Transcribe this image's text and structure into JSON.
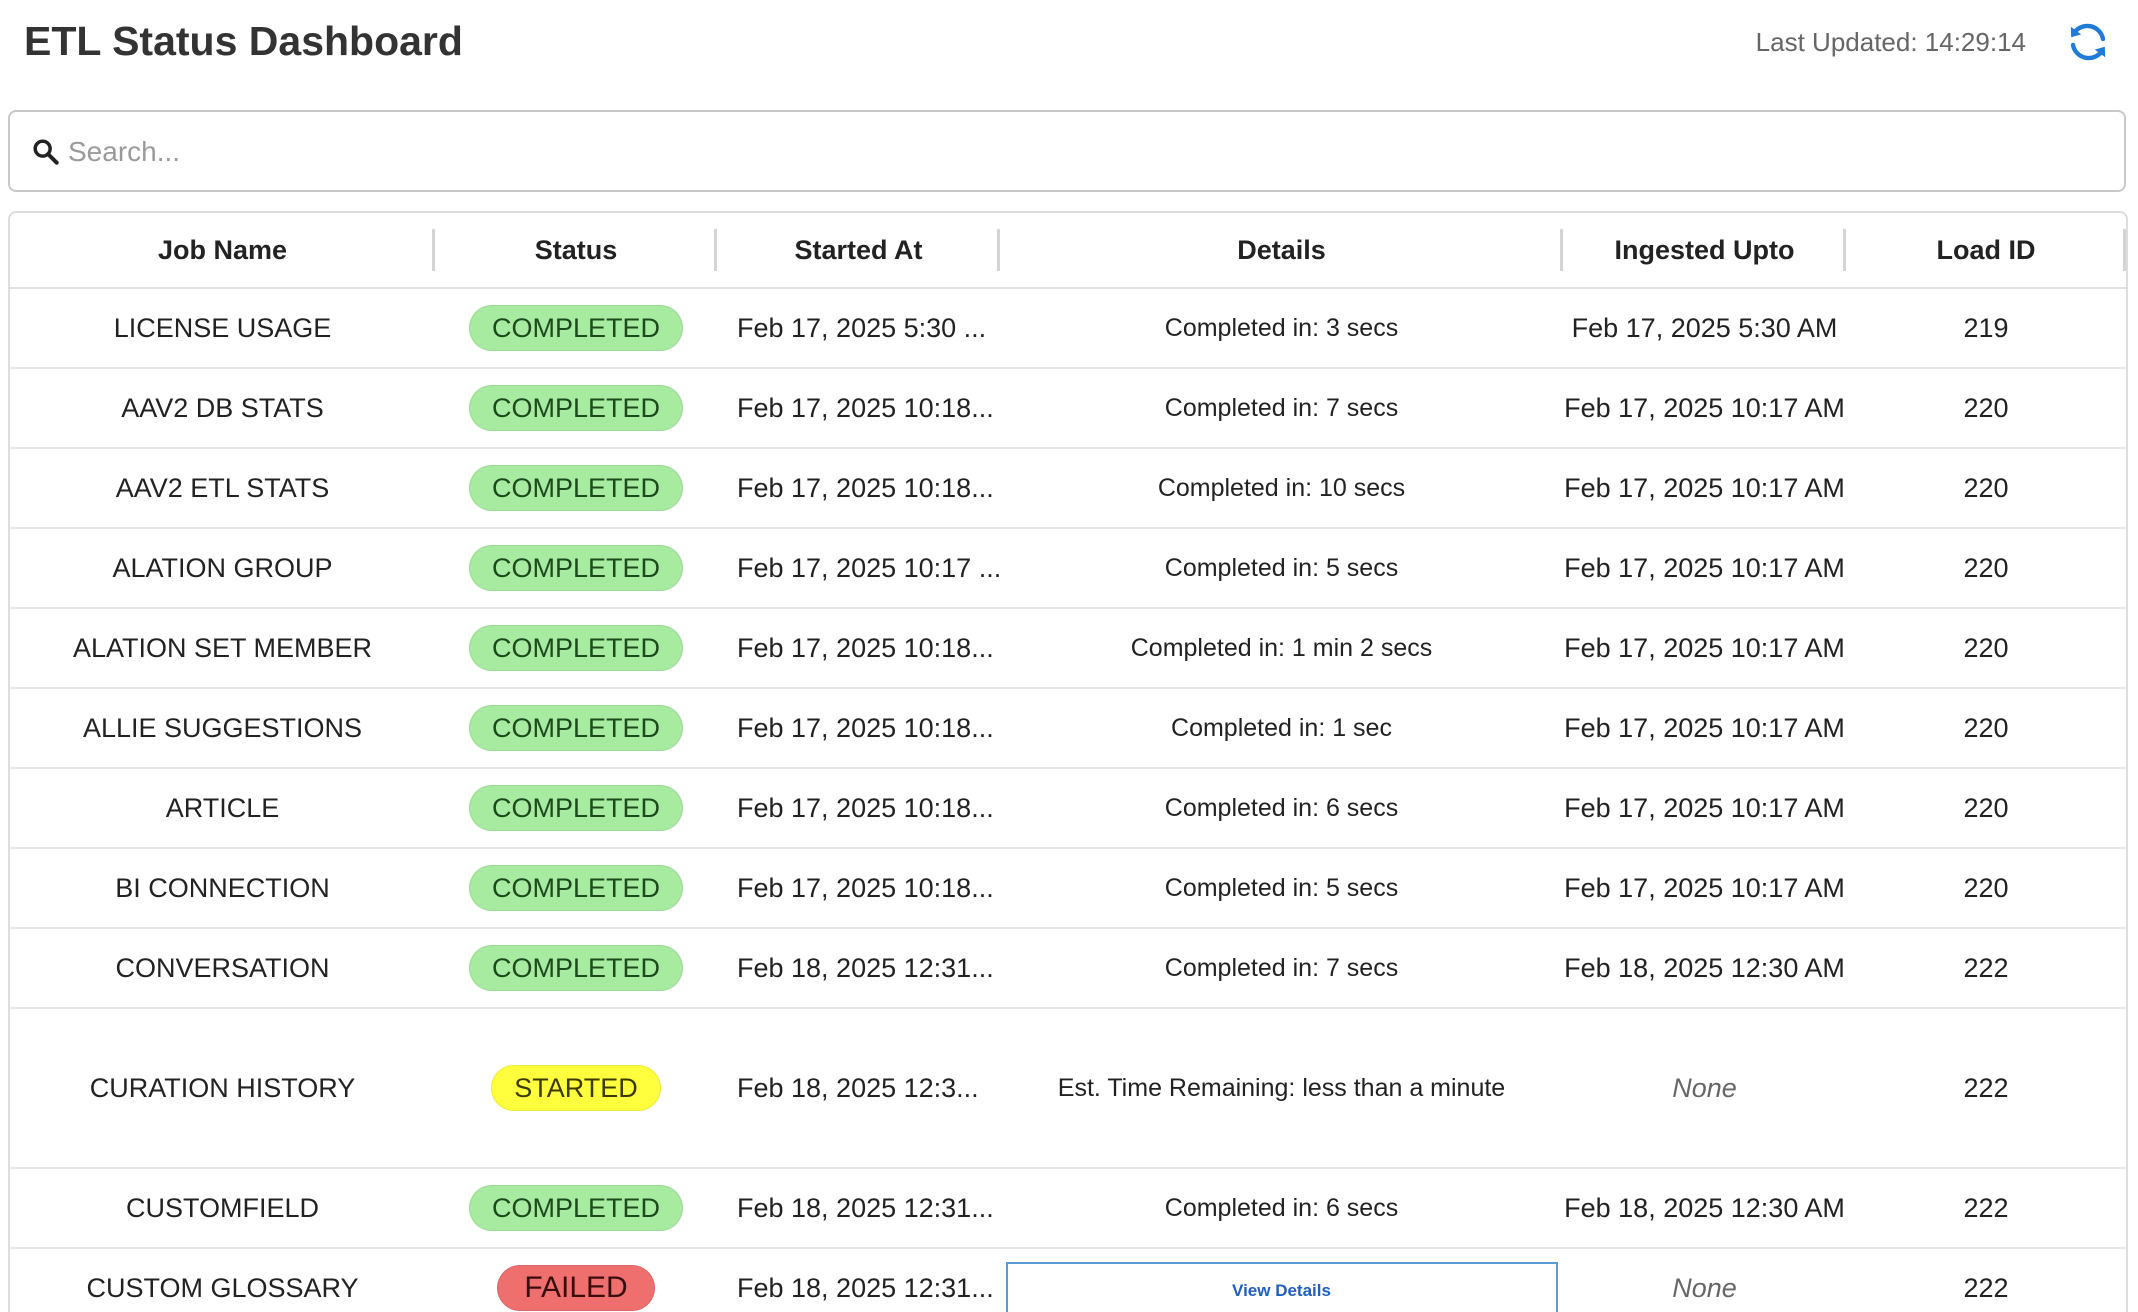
{
  "header": {
    "title": "ETL Status Dashboard",
    "last_updated": "Last Updated: 14:29:14",
    "refresh_icon": "refresh-icon",
    "accent_color": "#1f7bd6"
  },
  "search": {
    "placeholder": "Search...",
    "value": "",
    "icon": "search-icon"
  },
  "table": {
    "columns": [
      "Job Name",
      "Status",
      "Started At",
      "Details",
      "Ingested Upto",
      "Load ID"
    ],
    "rows": [
      {
        "job": "LICENSE USAGE",
        "status": "COMPLETED",
        "started": "Feb 17, 2025 5:30 ...",
        "details": "Completed in: 3 secs",
        "ingested": "Feb 17, 2025 5:30 AM",
        "load_id": "219"
      },
      {
        "job": "AAV2 DB STATS",
        "status": "COMPLETED",
        "started": "Feb 17, 2025 10:18...",
        "details": "Completed in: 7 secs",
        "ingested": "Feb 17, 2025 10:17 AM",
        "load_id": "220"
      },
      {
        "job": "AAV2 ETL STATS",
        "status": "COMPLETED",
        "started": "Feb 17, 2025 10:18...",
        "details": "Completed in: 10 secs",
        "ingested": "Feb 17, 2025 10:17 AM",
        "load_id": "220"
      },
      {
        "job": "ALATION GROUP",
        "status": "COMPLETED",
        "started": "Feb 17, 2025 10:17 ...",
        "details": "Completed in: 5 secs",
        "ingested": "Feb 17, 2025 10:17 AM",
        "load_id": "220"
      },
      {
        "job": "ALATION SET MEMBER",
        "status": "COMPLETED",
        "started": "Feb 17, 2025 10:18...",
        "details": "Completed in: 1 min 2 secs",
        "ingested": "Feb 17, 2025 10:17 AM",
        "load_id": "220"
      },
      {
        "job": "ALLIE SUGGESTIONS",
        "status": "COMPLETED",
        "started": "Feb 17, 2025 10:18...",
        "details": "Completed in: 1 sec",
        "ingested": "Feb 17, 2025 10:17 AM",
        "load_id": "220"
      },
      {
        "job": "ARTICLE",
        "status": "COMPLETED",
        "started": "Feb 17, 2025 10:18...",
        "details": "Completed in: 6 secs",
        "ingested": "Feb 17, 2025 10:17 AM",
        "load_id": "220"
      },
      {
        "job": "BI CONNECTION",
        "status": "COMPLETED",
        "started": "Feb 17, 2025 10:18...",
        "details": "Completed in: 5 secs",
        "ingested": "Feb 17, 2025 10:17 AM",
        "load_id": "220"
      },
      {
        "job": "CONVERSATION",
        "status": "COMPLETED",
        "started": "Feb 18, 2025 12:31...",
        "details": "Completed in: 7 secs",
        "ingested": "Feb 18, 2025 12:30 AM",
        "load_id": "222"
      },
      {
        "job": "CURATION HISTORY",
        "status": "STARTED",
        "started": "Feb 18, 2025 12:3...",
        "details": "Est. Time Remaining: less than a minute",
        "ingested": "None",
        "load_id": "222"
      },
      {
        "job": "CUSTOMFIELD",
        "status": "COMPLETED",
        "started": "Feb 18, 2025 12:31...",
        "details": "Completed in: 6 secs",
        "ingested": "Feb 18, 2025 12:30 AM",
        "load_id": "222"
      },
      {
        "job": "CUSTOM GLOSSARY",
        "status": "FAILED",
        "started": "Feb 18, 2025 12:31...",
        "details": "View Details",
        "ingested": "None",
        "load_id": "222"
      }
    ]
  },
  "status_colors": {
    "COMPLETED": "#a7eba0",
    "STARTED": "#ffff3d",
    "FAILED": "#ef6f6f"
  }
}
